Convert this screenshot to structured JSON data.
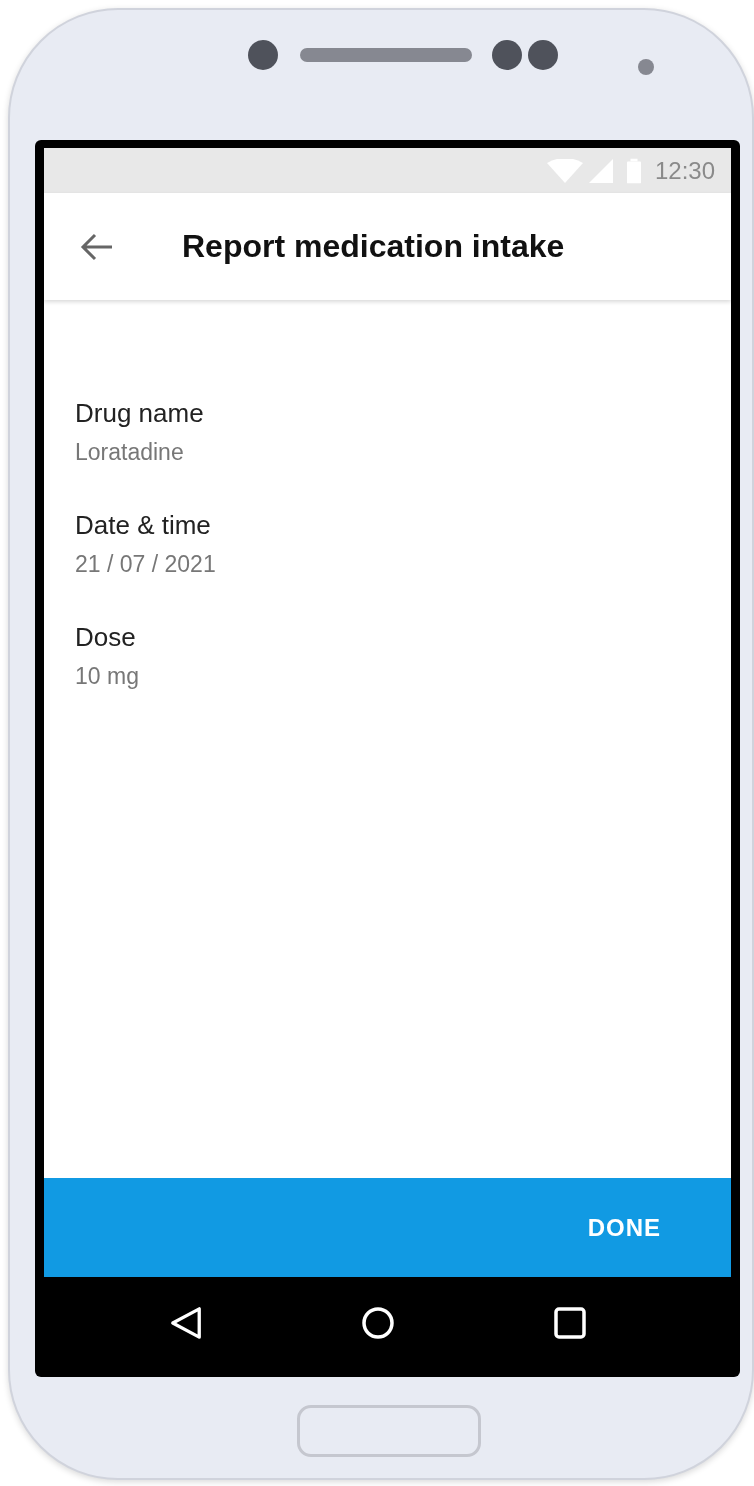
{
  "status_bar": {
    "time": "12:30"
  },
  "app_bar": {
    "title": "Report medication intake"
  },
  "fields": [
    {
      "label": "Drug name",
      "value": "Loratadine"
    },
    {
      "label": "Date & time",
      "value": "21 / 07 / 2021"
    },
    {
      "label": "Dose",
      "value": "10 mg"
    }
  ],
  "action_bar": {
    "button": "DONE"
  }
}
